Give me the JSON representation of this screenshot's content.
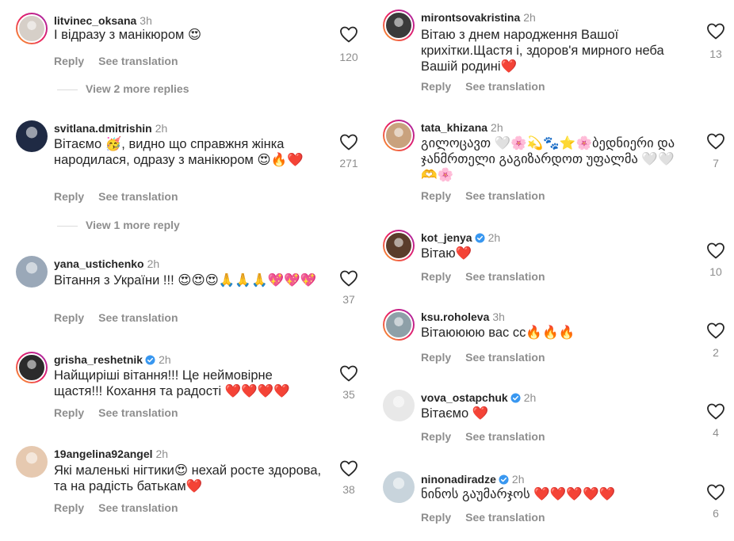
{
  "actions": {
    "reply": "Reply",
    "translate": "See translation"
  },
  "left": [
    {
      "user": "litvinec_oksana",
      "time": "3h",
      "verified": false,
      "ring": true,
      "avatar_color": "#d6cfc8",
      "text": "І відразу з манікюром 😍",
      "likes": "120",
      "replies": "View 2 more replies"
    },
    {
      "user": "svitlana.dmitrishin",
      "time": "2h",
      "verified": false,
      "ring": false,
      "avatar_color": "#1f2a44",
      "text": "Вітаємо 🥳, видно що справжня жінка народилася, одразу з манікюром 😍🔥❤️",
      "likes": "271",
      "replies": "View 1 more reply"
    },
    {
      "user": "yana_ustichenko",
      "time": "2h",
      "verified": false,
      "ring": false,
      "avatar_color": "#9aa8b8",
      "text": "Вітання з України !!! 😍😍😍🙏🙏🙏💖💖💖",
      "likes": "37"
    },
    {
      "user": "grisha_reshetnik",
      "time": "2h",
      "verified": true,
      "ring": true,
      "avatar_color": "#2b2b2b",
      "text": "Найщиріші вітання!!! Це неймовірне щастя!!! Кохання та радості ❤️❤️❤️❤️",
      "likes": "35"
    },
    {
      "user": "19angelina92angel",
      "time": "2h",
      "verified": false,
      "ring": false,
      "avatar_color": "#e6c9b0",
      "text": "Які маленькі нігтики😍 нехай росте здорова, та на радість батькам❤️",
      "likes": "38"
    }
  ],
  "right": [
    {
      "user": "mirontsovakristina",
      "time": "2h",
      "verified": false,
      "ring": true,
      "avatar_color": "#3a3a3a",
      "text": "Вітаю з днем народження Вашої крихітки.Щастя і, здоров'я мирного неба Вашій родині❤️",
      "likes": "13"
    },
    {
      "user": "tata_khizana",
      "time": "2h",
      "verified": false,
      "ring": true,
      "avatar_color": "#c9a27e",
      "text": "გილოცავთ 🤍🌸💫🐾⭐🌸ბედნიერი და ჯანმრთელი გაგიზარდოთ უფალმა 🤍🤍🫶🌸",
      "likes": "7"
    },
    {
      "user": "kot_jenya",
      "time": "2h",
      "verified": true,
      "ring": true,
      "avatar_color": "#5a3d2b",
      "text": "Вітаю❤️",
      "likes": "10"
    },
    {
      "user": "ksu.roholeva",
      "time": "3h",
      "verified": false,
      "ring": true,
      "avatar_color": "#8ea0a8",
      "text": "Вітаюююю вас сс🔥🔥🔥",
      "likes": "2"
    },
    {
      "user": "vova_ostapchuk",
      "time": "2h",
      "verified": true,
      "ring": false,
      "avatar_color": "#e8e8e8",
      "text": "Вітаємо ❤️",
      "likes": "4"
    },
    {
      "user": "ninonadiradze",
      "time": "2h",
      "verified": true,
      "ring": false,
      "avatar_color": "#c8d4dc",
      "text": "ნინოს გაუმარჯოს ❤️❤️❤️❤️❤️",
      "likes": "6"
    }
  ]
}
